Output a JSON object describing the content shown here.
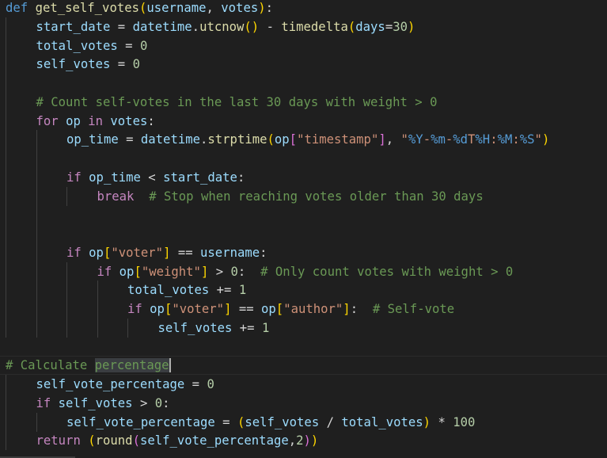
{
  "editor": {
    "theme_colors": {
      "background": "#1f1f1f",
      "keyword": "#569cd6",
      "control": "#c586c0",
      "function": "#dcdcaa",
      "variable": "#9cdcfe",
      "string": "#ce9178",
      "number": "#b5cea8",
      "comment": "#6a9955",
      "bracket_1": "#ffd700",
      "bracket_2": "#da70d6",
      "bracket_3": "#179fff"
    },
    "selected_word": "percentage",
    "lines": [
      {
        "indent": 0,
        "tokens": [
          [
            "kw",
            "def"
          ],
          [
            "txt",
            " "
          ],
          [
            "fn",
            "get_self_votes"
          ],
          [
            "br1",
            "("
          ],
          [
            "var",
            "username"
          ],
          [
            "txt",
            ", "
          ],
          [
            "var",
            "votes"
          ],
          [
            "br1",
            ")"
          ],
          [
            "txt",
            ":"
          ]
        ]
      },
      {
        "indent": 1,
        "tokens": [
          [
            "var",
            "start_date"
          ],
          [
            "txt",
            " = "
          ],
          [
            "var",
            "datetime"
          ],
          [
            "txt",
            "."
          ],
          [
            "fn",
            "utcnow"
          ],
          [
            "br1",
            "()"
          ],
          [
            "txt",
            " - "
          ],
          [
            "fn",
            "timedelta"
          ],
          [
            "br1",
            "("
          ],
          [
            "var",
            "days"
          ],
          [
            "txt",
            "="
          ],
          [
            "num",
            "30"
          ],
          [
            "br1",
            ")"
          ]
        ]
      },
      {
        "indent": 1,
        "tokens": [
          [
            "var",
            "total_votes"
          ],
          [
            "txt",
            " = "
          ],
          [
            "num",
            "0"
          ]
        ]
      },
      {
        "indent": 1,
        "tokens": [
          [
            "var",
            "self_votes"
          ],
          [
            "txt",
            " = "
          ],
          [
            "num",
            "0"
          ]
        ]
      },
      {
        "indent": 1,
        "tokens": []
      },
      {
        "indent": 1,
        "tokens": [
          [
            "cmt",
            "# Count self-votes in the last 30 days with weight > 0"
          ]
        ]
      },
      {
        "indent": 1,
        "tokens": [
          [
            "ctrl",
            "for"
          ],
          [
            "txt",
            " "
          ],
          [
            "var",
            "op"
          ],
          [
            "txt",
            " "
          ],
          [
            "ctrl",
            "in"
          ],
          [
            "txt",
            " "
          ],
          [
            "var",
            "votes"
          ],
          [
            "txt",
            ":"
          ]
        ]
      },
      {
        "indent": 2,
        "tokens": [
          [
            "var",
            "op_time"
          ],
          [
            "txt",
            " = "
          ],
          [
            "var",
            "datetime"
          ],
          [
            "txt",
            "."
          ],
          [
            "fn",
            "strptime"
          ],
          [
            "br1",
            "("
          ],
          [
            "var",
            "op"
          ],
          [
            "br2",
            "["
          ],
          [
            "str",
            "\"timestamp\""
          ],
          [
            "br2",
            "]"
          ],
          [
            "txt",
            ", "
          ],
          [
            "str",
            "\""
          ],
          [
            "esc",
            "%Y"
          ],
          [
            "str",
            "-"
          ],
          [
            "esc",
            "%m"
          ],
          [
            "str",
            "-"
          ],
          [
            "esc",
            "%d"
          ],
          [
            "str",
            "T"
          ],
          [
            "esc",
            "%H"
          ],
          [
            "str",
            ":"
          ],
          [
            "esc",
            "%M"
          ],
          [
            "str",
            ":"
          ],
          [
            "esc",
            "%S"
          ],
          [
            "str",
            "\""
          ],
          [
            "br1",
            ")"
          ]
        ]
      },
      {
        "indent": 2,
        "tokens": []
      },
      {
        "indent": 2,
        "tokens": [
          [
            "ctrl",
            "if"
          ],
          [
            "txt",
            " "
          ],
          [
            "var",
            "op_time"
          ],
          [
            "txt",
            " < "
          ],
          [
            "var",
            "start_date"
          ],
          [
            "txt",
            ":"
          ]
        ]
      },
      {
        "indent": 3,
        "tokens": [
          [
            "ctrl",
            "break"
          ],
          [
            "txt",
            "  "
          ],
          [
            "cmt",
            "# Stop when reaching votes older than 30 days"
          ]
        ]
      },
      {
        "indent": 2,
        "tokens": []
      },
      {
        "indent": 2,
        "tokens": []
      },
      {
        "indent": 2,
        "tokens": [
          [
            "ctrl",
            "if"
          ],
          [
            "txt",
            " "
          ],
          [
            "var",
            "op"
          ],
          [
            "br1",
            "["
          ],
          [
            "str",
            "\"voter\""
          ],
          [
            "br1",
            "]"
          ],
          [
            "txt",
            " == "
          ],
          [
            "var",
            "username"
          ],
          [
            "txt",
            ":"
          ]
        ]
      },
      {
        "indent": 3,
        "tokens": [
          [
            "ctrl",
            "if"
          ],
          [
            "txt",
            " "
          ],
          [
            "var",
            "op"
          ],
          [
            "br1",
            "["
          ],
          [
            "str",
            "\"weight\""
          ],
          [
            "br1",
            "]"
          ],
          [
            "txt",
            " > "
          ],
          [
            "num",
            "0"
          ],
          [
            "txt",
            ":  "
          ],
          [
            "cmt",
            "# Only count votes with weight > 0"
          ]
        ]
      },
      {
        "indent": 4,
        "tokens": [
          [
            "var",
            "total_votes"
          ],
          [
            "txt",
            " += "
          ],
          [
            "num",
            "1"
          ]
        ]
      },
      {
        "indent": 4,
        "tokens": [
          [
            "ctrl",
            "if"
          ],
          [
            "txt",
            " "
          ],
          [
            "var",
            "op"
          ],
          [
            "br1",
            "["
          ],
          [
            "str",
            "\"voter\""
          ],
          [
            "br1",
            "]"
          ],
          [
            "txt",
            " == "
          ],
          [
            "var",
            "op"
          ],
          [
            "br1",
            "["
          ],
          [
            "str",
            "\"author\""
          ],
          [
            "br1",
            "]"
          ],
          [
            "txt",
            ":  "
          ],
          [
            "cmt",
            "# Self-vote"
          ]
        ]
      },
      {
        "indent": 5,
        "tokens": [
          [
            "var",
            "self_votes"
          ],
          [
            "txt",
            " += "
          ],
          [
            "num",
            "1"
          ]
        ]
      },
      {
        "indent": 0,
        "tokens": []
      },
      {
        "indent": 0,
        "current": true,
        "tokens": [
          [
            "cmt",
            "# Calculate "
          ],
          [
            "cmtsel",
            "percentage"
          ]
        ]
      },
      {
        "indent": 1,
        "tokens": [
          [
            "var",
            "self_vote_percentage"
          ],
          [
            "txt",
            " = "
          ],
          [
            "num",
            "0"
          ]
        ]
      },
      {
        "indent": 1,
        "tokens": [
          [
            "ctrl",
            "if"
          ],
          [
            "txt",
            " "
          ],
          [
            "var",
            "self_votes"
          ],
          [
            "txt",
            " > "
          ],
          [
            "num",
            "0"
          ],
          [
            "txt",
            ":"
          ]
        ]
      },
      {
        "indent": 2,
        "tokens": [
          [
            "var",
            "self_vote_percentage"
          ],
          [
            "txt",
            " = "
          ],
          [
            "br1",
            "("
          ],
          [
            "var",
            "self_votes"
          ],
          [
            "txt",
            " / "
          ],
          [
            "var",
            "total_votes"
          ],
          [
            "br1",
            ")"
          ],
          [
            "txt",
            " * "
          ],
          [
            "num",
            "100"
          ]
        ]
      },
      {
        "indent": 1,
        "tokens": [
          [
            "ctrl",
            "return"
          ],
          [
            "txt",
            " "
          ],
          [
            "br1",
            "("
          ],
          [
            "fn",
            "round"
          ],
          [
            "br2",
            "("
          ],
          [
            "var",
            "self_vote_percentage"
          ],
          [
            "txt",
            ","
          ],
          [
            "num",
            "2"
          ],
          [
            "br2",
            ")"
          ],
          [
            "br1",
            ")"
          ]
        ]
      }
    ]
  }
}
